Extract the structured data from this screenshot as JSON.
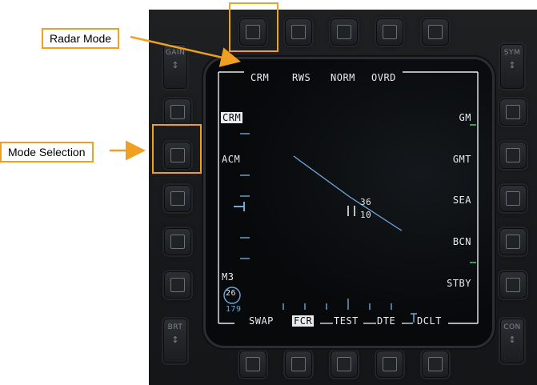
{
  "callouts": {
    "radar_mode": "Radar Mode",
    "mode_selection": "Mode Selection"
  },
  "bezel": {
    "rockers": {
      "gain": "GAIN",
      "sym": "SYM",
      "brt": "BRT",
      "con": "CON"
    }
  },
  "mfd": {
    "top_labels": [
      "CRM",
      "RWS",
      "NORM",
      "OVRD"
    ],
    "left_labels": {
      "crm": "CRM",
      "acm": "ACM",
      "m3": "M3"
    },
    "right_labels": [
      "GM",
      "GMT",
      "SEA",
      "BCN",
      "STBY"
    ],
    "bottom_labels": {
      "swap": "SWAP",
      "fcr": "FCR",
      "test": "TEST",
      "dte": "DTE",
      "dclt": "DCLT"
    },
    "range_scale": "26",
    "azimuth": "179",
    "cursor_upper": "36",
    "cursor_lower": "10",
    "colors": {
      "symbology": "#e9ecef",
      "radar_blue": "#6fa8dc",
      "callout": "#f0a020",
      "tick_green": "#58c85a"
    }
  }
}
